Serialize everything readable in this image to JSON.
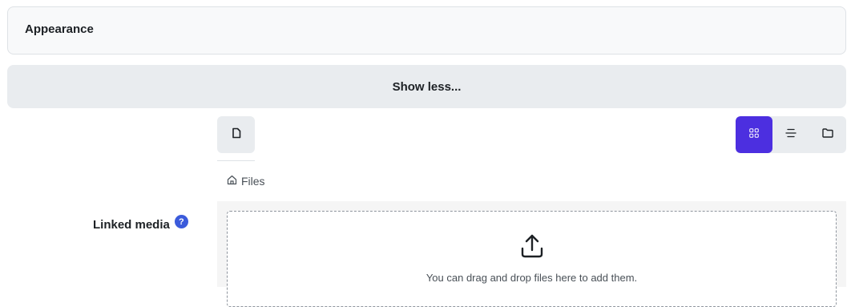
{
  "appearance": {
    "title": "Appearance"
  },
  "toggle": {
    "show_less_label": "Show less..."
  },
  "file_manager": {
    "add_file_icon": "file-icon",
    "view_modes": [
      {
        "name": "icons-view",
        "icon": "grid-icon",
        "active": true
      },
      {
        "name": "list-view",
        "icon": "list-icon",
        "active": false
      },
      {
        "name": "tree-view",
        "icon": "folder-icon",
        "active": false
      }
    ],
    "breadcrumb": {
      "icon": "home-icon",
      "label": "Files"
    },
    "dropzone_text": "You can drag and drop files here to add them.",
    "upload_icon": "upload-icon"
  },
  "field": {
    "label": "Linked media",
    "help_icon": "help-icon"
  },
  "colors": {
    "accent": "#4c2fe0",
    "help": "#3b5bdb",
    "panel_bg": "#f8f9fa",
    "button_bg": "#e9ecef"
  }
}
